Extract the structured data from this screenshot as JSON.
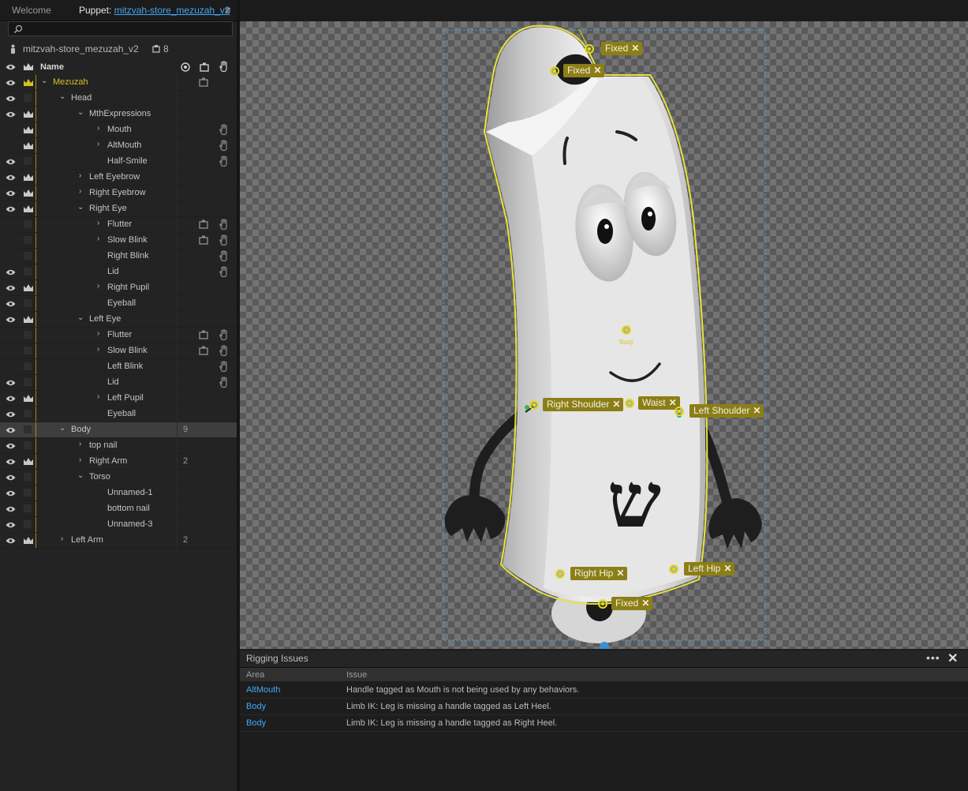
{
  "tabs": {
    "welcome": "Welcome",
    "puppet_prefix": "Puppet:",
    "puppet_name": "mitzvah-store_mezuzah_v2",
    "menu_icon": "hamburger-icon"
  },
  "search": {
    "placeholder": "",
    "icon": "search-icon"
  },
  "puppet": {
    "name": "mitzvah-store_mezuzah_v2",
    "count": "8"
  },
  "columns": {
    "name": "Name"
  },
  "layers": [
    {
      "name": "Mezuzah",
      "depth": 0,
      "chev": "down",
      "eye": true,
      "crown": true,
      "count": "",
      "ic1": true,
      "ic2": false
    },
    {
      "name": "Head",
      "depth": 1,
      "chev": "down",
      "eye": true,
      "crown": false,
      "count": "",
      "ic1": false,
      "ic2": false
    },
    {
      "name": "MthExpressions",
      "depth": 2,
      "chev": "down",
      "eye": true,
      "crown": true,
      "count": "",
      "ic1": false,
      "ic2": false
    },
    {
      "name": "Mouth",
      "depth": 3,
      "chev": "right",
      "eye": false,
      "crown": true,
      "count": "",
      "ic1": false,
      "ic2": true
    },
    {
      "name": "AltMouth",
      "depth": 3,
      "chev": "right",
      "eye": false,
      "crown": true,
      "count": "",
      "ic1": false,
      "ic2": true
    },
    {
      "name": "Half-Smile",
      "depth": 3,
      "chev": "",
      "eye": true,
      "crown": false,
      "count": "",
      "ic1": false,
      "ic2": true
    },
    {
      "name": "Left Eyebrow",
      "depth": 2,
      "chev": "right",
      "eye": true,
      "crown": true,
      "count": "",
      "ic1": false,
      "ic2": false
    },
    {
      "name": "Right Eyebrow",
      "depth": 2,
      "chev": "right",
      "eye": true,
      "crown": true,
      "count": "",
      "ic1": false,
      "ic2": false
    },
    {
      "name": "Right Eye",
      "depth": 2,
      "chev": "down",
      "eye": true,
      "crown": true,
      "count": "",
      "ic1": false,
      "ic2": false
    },
    {
      "name": "Flutter",
      "depth": 3,
      "chev": "right",
      "eye": false,
      "crown": false,
      "count": "",
      "ic1": true,
      "ic2": true
    },
    {
      "name": "Slow Blink",
      "depth": 3,
      "chev": "right",
      "eye": false,
      "crown": false,
      "count": "",
      "ic1": true,
      "ic2": true
    },
    {
      "name": "Right Blink",
      "depth": 3,
      "chev": "",
      "eye": false,
      "crown": false,
      "count": "",
      "ic1": false,
      "ic2": true
    },
    {
      "name": "Lid",
      "depth": 3,
      "chev": "",
      "eye": true,
      "crown": false,
      "count": "",
      "ic1": false,
      "ic2": true
    },
    {
      "name": "Right Pupil",
      "depth": 3,
      "chev": "right",
      "eye": true,
      "crown": true,
      "count": "",
      "ic1": false,
      "ic2": false
    },
    {
      "name": "Eyeball",
      "depth": 3,
      "chev": "",
      "eye": true,
      "crown": false,
      "count": "",
      "ic1": false,
      "ic2": false
    },
    {
      "name": "Left Eye",
      "depth": 2,
      "chev": "down",
      "eye": true,
      "crown": true,
      "count": "",
      "ic1": false,
      "ic2": false
    },
    {
      "name": "Flutter",
      "depth": 3,
      "chev": "right",
      "eye": false,
      "crown": false,
      "count": "",
      "ic1": true,
      "ic2": true
    },
    {
      "name": "Slow Blink",
      "depth": 3,
      "chev": "right",
      "eye": false,
      "crown": false,
      "count": "",
      "ic1": true,
      "ic2": true
    },
    {
      "name": "Left Blink",
      "depth": 3,
      "chev": "",
      "eye": false,
      "crown": false,
      "count": "",
      "ic1": false,
      "ic2": true
    },
    {
      "name": "Lid",
      "depth": 3,
      "chev": "",
      "eye": true,
      "crown": false,
      "count": "",
      "ic1": false,
      "ic2": true
    },
    {
      "name": "Left Pupil",
      "depth": 3,
      "chev": "right",
      "eye": true,
      "crown": true,
      "count": "",
      "ic1": false,
      "ic2": false
    },
    {
      "name": "Eyeball",
      "depth": 3,
      "chev": "",
      "eye": true,
      "crown": false,
      "count": "",
      "ic1": false,
      "ic2": false
    },
    {
      "name": "Body",
      "depth": 1,
      "chev": "down",
      "eye": true,
      "crown": false,
      "count": "9",
      "ic1": false,
      "ic2": false,
      "selected": true
    },
    {
      "name": "top nail",
      "depth": 2,
      "chev": "right",
      "eye": true,
      "crown": false,
      "count": "",
      "ic1": false,
      "ic2": false
    },
    {
      "name": "Right Arm",
      "depth": 2,
      "chev": "right",
      "eye": true,
      "crown": true,
      "count": "2",
      "ic1": false,
      "ic2": false
    },
    {
      "name": "Torso",
      "depth": 2,
      "chev": "down",
      "eye": true,
      "crown": false,
      "count": "",
      "ic1": false,
      "ic2": false
    },
    {
      "name": "Unnamed-1",
      "depth": 3,
      "chev": "",
      "eye": true,
      "crown": false,
      "count": "",
      "ic1": false,
      "ic2": false
    },
    {
      "name": "bottom nail",
      "depth": 3,
      "chev": "",
      "eye": true,
      "crown": false,
      "count": "",
      "ic1": false,
      "ic2": false
    },
    {
      "name": "Unnamed-3",
      "depth": 3,
      "chev": "",
      "eye": true,
      "crown": false,
      "count": "",
      "ic1": false,
      "ic2": false
    },
    {
      "name": "Left Arm",
      "depth": 1,
      "chev": "right",
      "eye": true,
      "crown": true,
      "count": "2",
      "ic1": false,
      "ic2": false
    }
  ],
  "canvas_handles": {
    "fixed_top_1": "Fixed",
    "fixed_top_2": "Fixed",
    "body": "Body",
    "right_shoulder": "Right Shoulder",
    "waist": "Waist",
    "left_shoulder": "Left Shoulder",
    "right_hip": "Right Hip",
    "left_hip": "Left Hip",
    "fixed_bottom": "Fixed"
  },
  "rigging": {
    "title": "Rigging Issues",
    "col_area": "Area",
    "col_issue": "Issue",
    "rows": [
      {
        "area": "AltMouth",
        "issue": "Handle tagged as Mouth is not being used by any behaviors."
      },
      {
        "area": "Body",
        "issue": "Limb IK: Leg is missing a handle tagged as Left Heel."
      },
      {
        "area": "Body",
        "issue": "Limb IK: Leg is missing a handle tagged as Right Heel."
      }
    ]
  },
  "colors": {
    "accent_blue": "#46a6f0",
    "handle_gold": "#8c7e16",
    "handle_ring": "#e2db26",
    "selection_yellow": "#e8e23a"
  }
}
